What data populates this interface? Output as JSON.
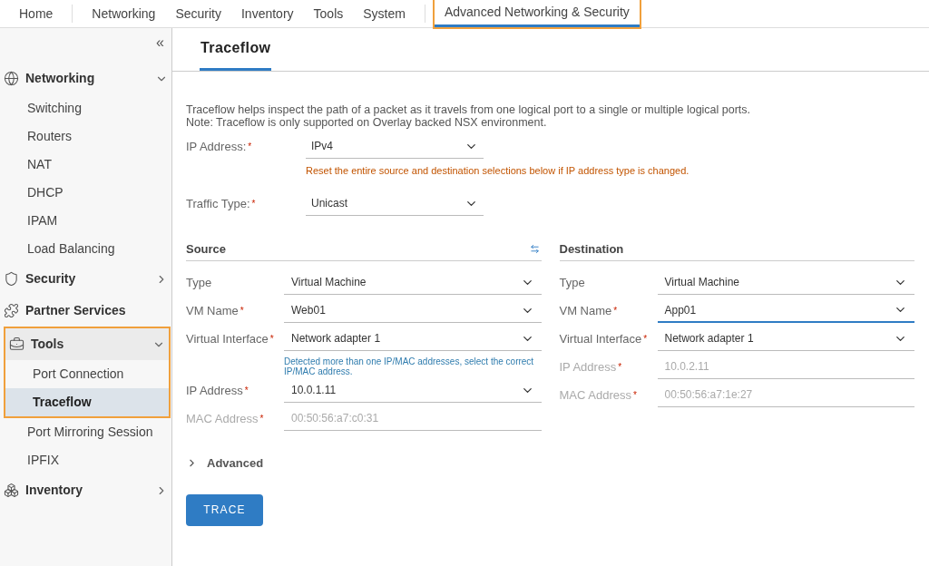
{
  "top_nav": [
    [
      {
        "label": "Home",
        "selected": false,
        "highlighted": false
      }
    ],
    [
      {
        "label": "Networking",
        "selected": false,
        "highlighted": false
      },
      {
        "label": "Security",
        "selected": false,
        "highlighted": false
      },
      {
        "label": "Inventory",
        "selected": false,
        "highlighted": false
      },
      {
        "label": "Tools",
        "selected": false,
        "highlighted": false
      },
      {
        "label": "System",
        "selected": false,
        "highlighted": false
      }
    ],
    [
      {
        "label": "Advanced Networking & Security",
        "selected": true,
        "highlighted": true
      }
    ]
  ],
  "sidebar": {
    "collapse_label": "«",
    "groups": [
      {
        "label": "Networking",
        "expanded": true,
        "highlighted": false,
        "children": [
          {
            "label": "Switching",
            "selected": false,
            "highlighted": false
          },
          {
            "label": "Routers",
            "selected": false,
            "highlighted": false
          },
          {
            "label": "NAT",
            "selected": false,
            "highlighted": false
          },
          {
            "label": "DHCP",
            "selected": false,
            "highlighted": false
          },
          {
            "label": "IPAM",
            "selected": false,
            "highlighted": false
          },
          {
            "label": "Load Balancing",
            "selected": false,
            "highlighted": false
          }
        ]
      },
      {
        "label": "Security",
        "expanded": false,
        "highlighted": false
      },
      {
        "label": "Partner Services",
        "highlighted": false
      },
      {
        "label": "Tools",
        "expanded": true,
        "highlighted": true,
        "children": [
          {
            "label": "Port Connection",
            "selected": false,
            "highlighted": true
          },
          {
            "label": "Traceflow",
            "selected": true,
            "highlighted": true
          },
          {
            "label": "Port Mirroring Session",
            "selected": false,
            "highlighted": false
          },
          {
            "label": "IPFIX",
            "selected": false,
            "highlighted": false
          }
        ]
      },
      {
        "label": "Inventory",
        "expanded": false,
        "highlighted": false
      }
    ]
  },
  "page": {
    "tab": "Traceflow",
    "required_mark": "*",
    "intro": [
      "Traceflow helps inspect the path of a packet as it travels from one logical port to a single or multiple logical ports.",
      "Note: Traceflow is only supported on Overlay backed NSX environment."
    ],
    "top_fields": [
      {
        "label": "IP Address:",
        "required": true,
        "value": "IPv4",
        "warning": "Reset the entire source and destination selections below if IP address type is changed."
      },
      {
        "label": "Traffic Type:",
        "required": true,
        "value": "Unicast"
      }
    ],
    "sections": [
      {
        "title": "Source",
        "swap": true,
        "fields": [
          {
            "kind": "dropdown",
            "label": "Type",
            "required": false,
            "value": "Virtual Machine",
            "focused": false
          },
          {
            "kind": "dropdown",
            "label": "VM Name",
            "required": true,
            "value": "Web01",
            "focused": false
          },
          {
            "kind": "dropdown",
            "label": "Virtual Interface",
            "required": true,
            "value": "Network adapter 1",
            "focused": false,
            "hint": "Detected more than one IP/MAC addresses, select the correct IP/MAC address."
          },
          {
            "kind": "dropdown",
            "label": "IP Address",
            "required": true,
            "value": "10.0.1.11",
            "focused": false
          },
          {
            "kind": "readonly",
            "label": "MAC Address",
            "required": true,
            "value": "00:50:56:a7:c0:31",
            "focused": false
          }
        ]
      },
      {
        "title": "Destination",
        "swap": false,
        "fields": [
          {
            "kind": "dropdown",
            "label": "Type",
            "required": false,
            "value": "Virtual Machine",
            "focused": false
          },
          {
            "kind": "dropdown",
            "label": "VM Name",
            "required": true,
            "value": "App01",
            "focused": true
          },
          {
            "kind": "dropdown",
            "label": "Virtual Interface",
            "required": true,
            "value": "Network adapter 1",
            "focused": false
          },
          {
            "kind": "readonly",
            "label": "IP Address",
            "required": true,
            "value": "10.0.2.11",
            "focused": false
          },
          {
            "kind": "readonly",
            "label": "MAC Address",
            "required": true,
            "value": "00:50:56:a7:1e:27",
            "focused": false
          }
        ]
      }
    ],
    "advanced": {
      "label": "Advanced",
      "expanded": false
    },
    "button": "TRACE"
  }
}
